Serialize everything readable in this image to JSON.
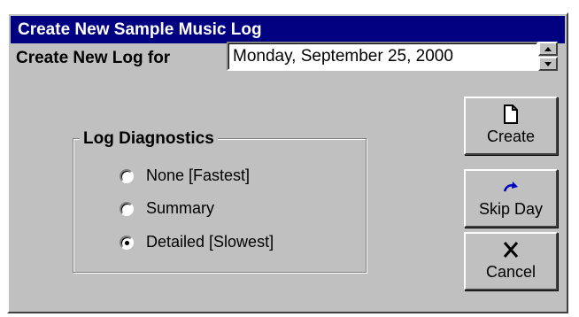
{
  "window": {
    "title": "Create New Sample Music Log"
  },
  "log_for": {
    "label": "Create New Log for",
    "date_value": "Monday, September 25, 2000"
  },
  "diagnostics": {
    "title": "Log Diagnostics",
    "options": [
      {
        "label": "None [Fastest]",
        "selected": false
      },
      {
        "label": "Summary",
        "selected": false
      },
      {
        "label": "Detailed [Slowest]",
        "selected": true
      }
    ]
  },
  "buttons": {
    "create": {
      "label": "Create",
      "icon": "document-icon"
    },
    "skip_day": {
      "label": "Skip Day",
      "icon": "redo-arrow-icon"
    },
    "cancel": {
      "label": "Cancel",
      "icon": "x-icon"
    }
  },
  "colors": {
    "titlebar": "#000080",
    "face": "#c0c0c0"
  }
}
